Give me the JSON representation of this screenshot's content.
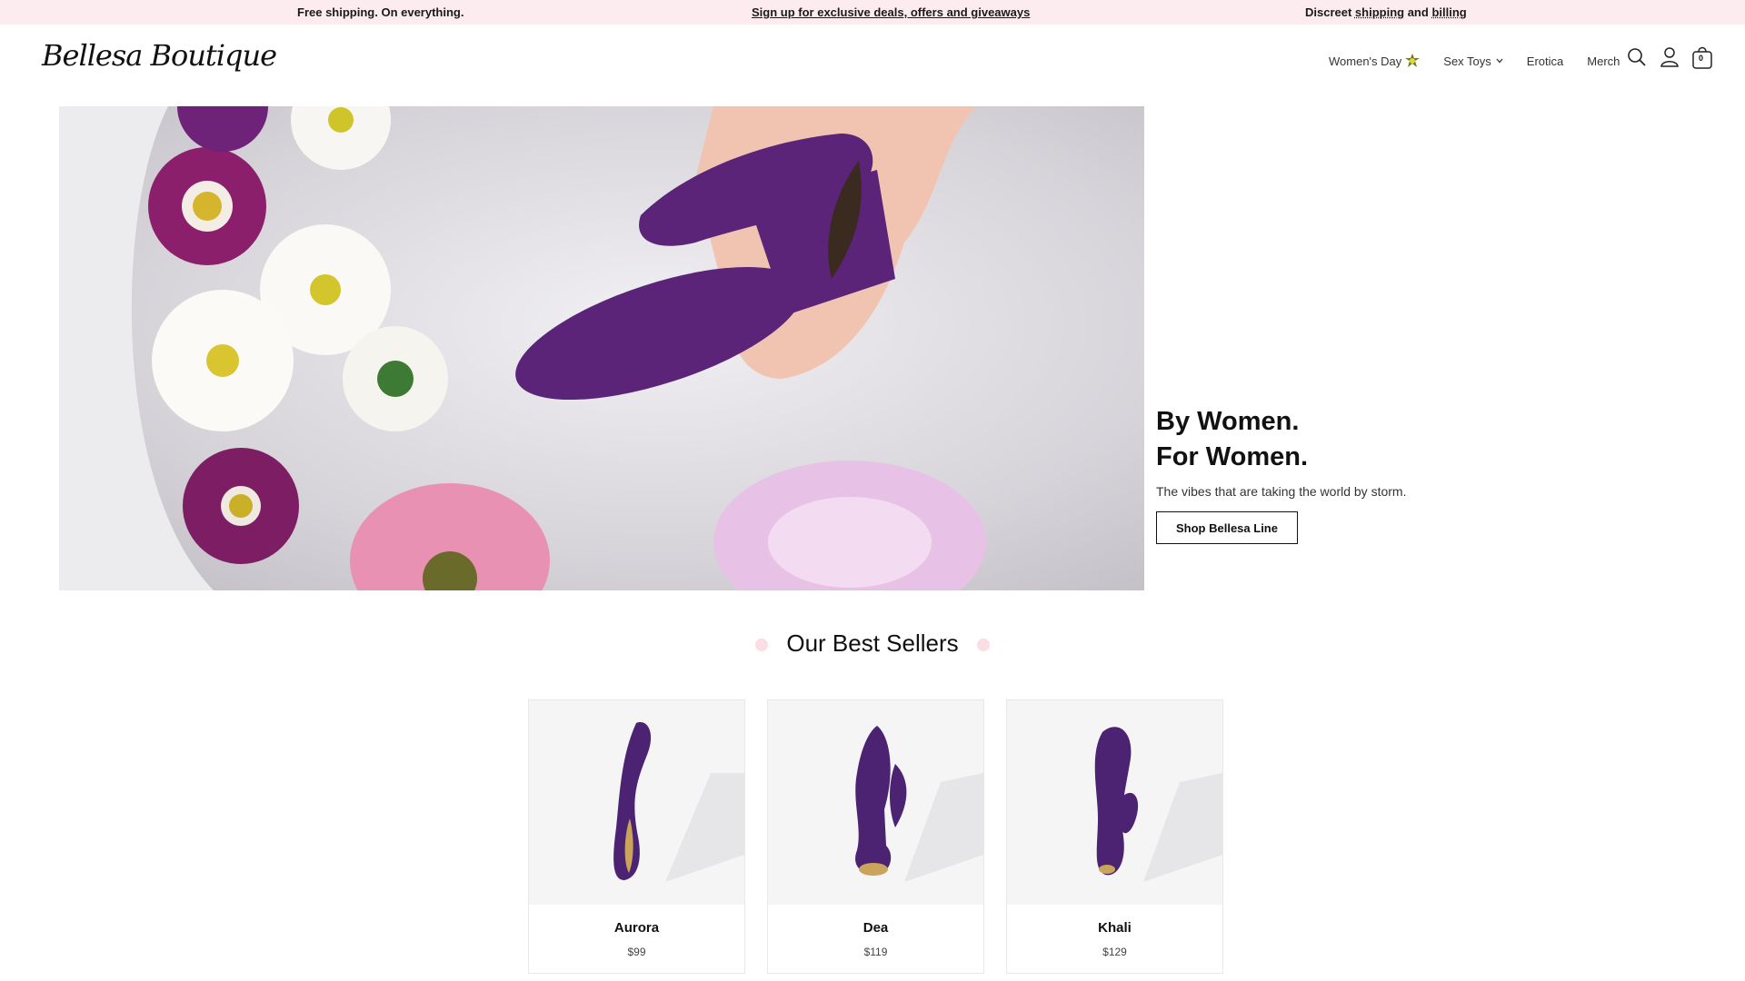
{
  "announcement": {
    "left": "Free shipping. On everything.",
    "center": "Sign up for exclusive deals, offers and giveaways",
    "right_prefix": "Discreet ",
    "right_link1": "shipping",
    "right_mid": " and ",
    "right_link2": "billing"
  },
  "header": {
    "logo": "Bellesa Boutique",
    "nav": [
      {
        "label": "Women's Day",
        "icon": "star-burst-icon"
      },
      {
        "label": "Sex Toys",
        "icon": "chevron-down-icon"
      },
      {
        "label": "Erotica"
      },
      {
        "label": "Merch"
      }
    ],
    "cart_count": "0"
  },
  "hero": {
    "title_line1": "By Women.",
    "title_line2": "For Women.",
    "subtitle": "The vibes that are taking the world by storm.",
    "button": "Shop Bellesa Line"
  },
  "best_sellers": {
    "title": "Our Best Sellers",
    "products": [
      {
        "name": "Aurora",
        "price": "$99"
      },
      {
        "name": "Dea",
        "price": "$119"
      },
      {
        "name": "Khali",
        "price": "$129"
      }
    ]
  },
  "colors": {
    "announce_bg": "#fdecef",
    "product_purple": "#5b2a86",
    "accent_pink": "#fbdde4"
  }
}
